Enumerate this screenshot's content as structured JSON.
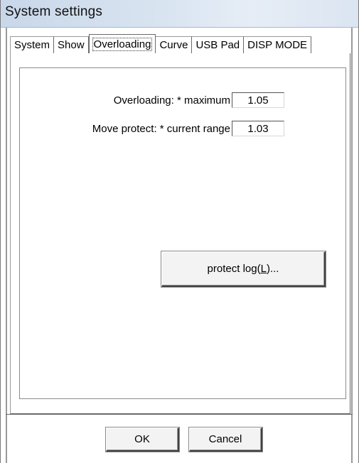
{
  "window": {
    "title": "System settings"
  },
  "tabs": [
    {
      "label": "System",
      "active": false
    },
    {
      "label": "Show",
      "active": false
    },
    {
      "label": "Overloading",
      "active": true
    },
    {
      "label": "Curve",
      "active": false
    },
    {
      "label": "USB Pad",
      "active": false
    },
    {
      "label": "DISP MODE",
      "active": false
    }
  ],
  "overloading": {
    "label": "Overloading:  * maximum",
    "value": "1.05"
  },
  "move_protect": {
    "label": "Move protect:  * current range",
    "value": "1.03"
  },
  "protect_log": {
    "label_before": "protect log(",
    "mnemonic": "L",
    "label_after": ")..."
  },
  "buttons": {
    "ok": "OK",
    "cancel": "Cancel"
  },
  "colors": {
    "titlebar": "#d9e4f1",
    "background": "#ffffff"
  }
}
